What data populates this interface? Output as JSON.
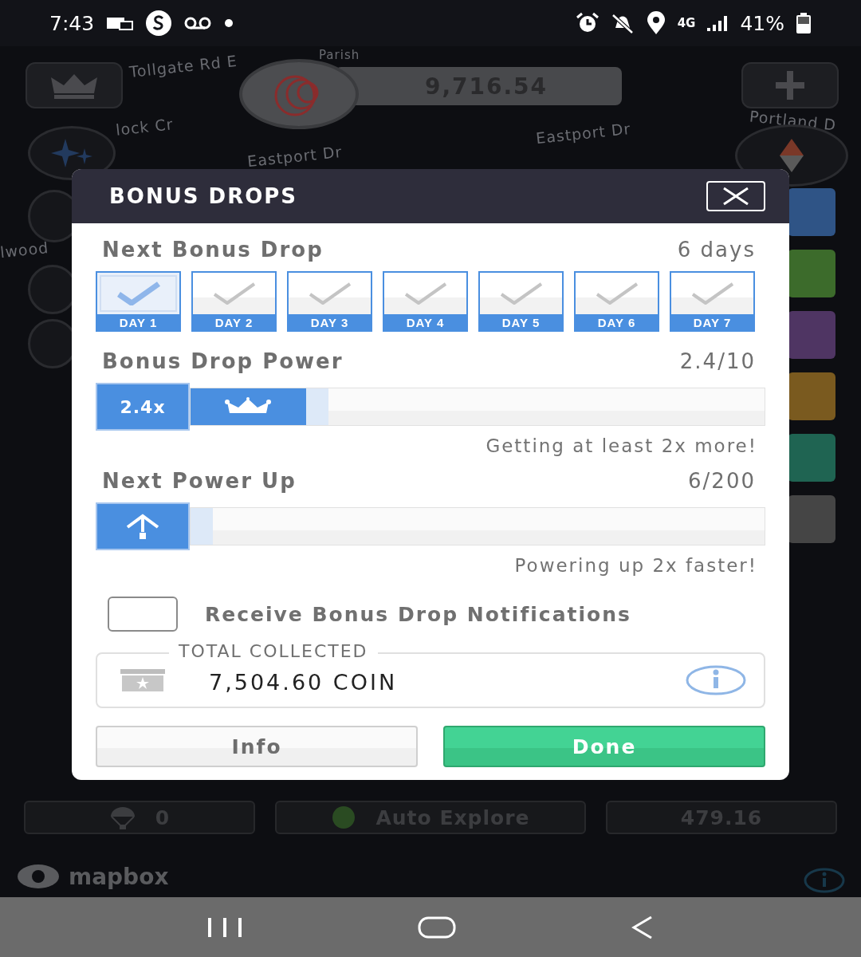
{
  "status_bar": {
    "time": "7:43",
    "network": "4G",
    "battery": "41%"
  },
  "map": {
    "balance": "9,716.54",
    "street_labels": [
      {
        "text": "Parish",
        "kind": "cut"
      },
      {
        "text": "Tollgate Rd E",
        "kind": "street"
      },
      {
        "text": "lock Cr",
        "kind": "street"
      },
      {
        "text": "Eastport Dr",
        "kind": "street"
      },
      {
        "text": "Eastport Dr",
        "kind": "street"
      },
      {
        "text": "lwood",
        "kind": "street"
      },
      {
        "text": "Portland D",
        "kind": "street"
      }
    ],
    "drops_count": "0",
    "auto_explore": "Auto Explore",
    "distance": "479.16",
    "attribution": "mapbox"
  },
  "dialog": {
    "title": "BONUS DROPS",
    "next_drop": {
      "label": "Next Bonus Drop",
      "value": "6 days"
    },
    "days": [
      {
        "label": "DAY 1",
        "checked": true
      },
      {
        "label": "DAY 2",
        "checked": false
      },
      {
        "label": "DAY 3",
        "checked": false
      },
      {
        "label": "DAY 4",
        "checked": false
      },
      {
        "label": "DAY 5",
        "checked": false
      },
      {
        "label": "DAY 6",
        "checked": false
      },
      {
        "label": "DAY 7",
        "checked": false
      }
    ],
    "power": {
      "label": "Bonus Drop Power",
      "value": "2.4/10",
      "badge": "2.4x",
      "level": 0.24,
      "note": "Getting at least 2x more!"
    },
    "power_up": {
      "label": "Next Power Up",
      "value": "6/200",
      "level": 0.03,
      "note": "Powering up 2x faster!"
    },
    "notifications": {
      "label": "Receive Bonus Drop Notifications",
      "checked": false
    },
    "total": {
      "legend": "TOTAL COLLECTED",
      "amount": "7,504.60 COIN"
    },
    "buttons": [
      {
        "label": "Info",
        "kind": "secondary"
      },
      {
        "label": "Done",
        "kind": "primary"
      }
    ]
  }
}
